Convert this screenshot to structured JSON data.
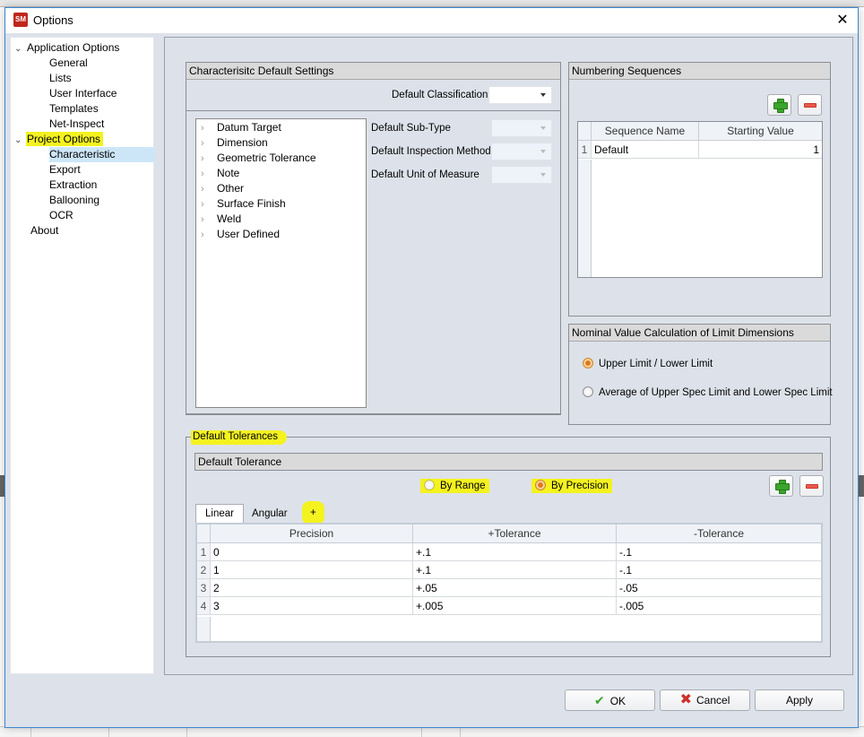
{
  "window": {
    "title": "Options",
    "app_icon": "app-logo-icon",
    "close_icon": "close-icon"
  },
  "nav": {
    "groups": [
      {
        "label": "Application Options",
        "expanded": true,
        "highlighted": false,
        "children": [
          "General",
          "Lists",
          "User Interface",
          "Templates",
          "Net-Inspect"
        ]
      },
      {
        "label": "Project Options",
        "expanded": true,
        "highlighted": true,
        "children": [
          "Characteristic",
          "Export",
          "Extraction",
          "Ballooning",
          "OCR"
        ]
      }
    ],
    "about": "About",
    "selected": "Characteristic"
  },
  "char_defaults": {
    "header": "Characterisitc Default Settings",
    "classification_label": "Default Classification",
    "classification_value": "",
    "tree_items": [
      "Datum Target",
      "Dimension",
      "Geometric Tolerance",
      "Note",
      "Other",
      "Surface Finish",
      "Weld",
      "User Defined"
    ],
    "subtype_label": "Default Sub-Type",
    "inspection_label": "Default Inspection Method",
    "uom_label": "Default Unit of Measure"
  },
  "numbering": {
    "header": "Numbering Sequences",
    "columns": [
      "Sequence Name",
      "Starting Value"
    ],
    "rows": [
      {
        "num": "1",
        "name": "Default",
        "start": "1"
      }
    ]
  },
  "nominal": {
    "header": "Nominal Value Calculation of Limit Dimensions",
    "options": [
      "Upper Limit / Lower Limit",
      "Average of Upper Spec Limit and Lower Spec Limit"
    ],
    "selected": 0
  },
  "tolerances": {
    "group_label": "Default Tolerances",
    "header": "Default Tolerance",
    "mode_options": [
      "By Range",
      "By Precision"
    ],
    "mode_selected": "By Precision",
    "tabs": [
      "Linear",
      "Angular",
      "+"
    ],
    "active_tab": "Linear",
    "columns": [
      "Precision",
      "+Tolerance",
      "-Tolerance"
    ],
    "rows": [
      {
        "num": "1",
        "precision": "0",
        "plus": "+.1",
        "minus": "-.1"
      },
      {
        "num": "2",
        "precision": "1",
        "plus": "+.1",
        "minus": "-.1"
      },
      {
        "num": "3",
        "precision": "2",
        "plus": "+.05",
        "minus": "-.05"
      },
      {
        "num": "4",
        "precision": "3",
        "plus": "+.005",
        "minus": "-.005"
      }
    ]
  },
  "footer": {
    "ok": "OK",
    "cancel": "Cancel",
    "apply": "Apply"
  },
  "colors": {
    "highlight": "#f4f21f",
    "selection": "#cde6f7",
    "add_green": "#3aa52c",
    "remove_red": "#ec5a4c",
    "radio_orange": "#e07818"
  }
}
